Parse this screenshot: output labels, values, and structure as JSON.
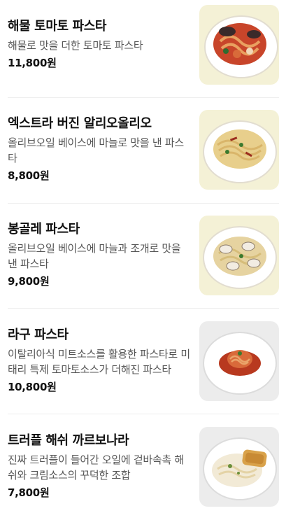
{
  "menu": {
    "items": [
      {
        "name": "해물 토마토 파스타",
        "description": "해물로 맛을 더한 토마토 파스타",
        "price": "11,800원",
        "image": "seafood-tomato-pasta-image",
        "bg": "#f4f1d6"
      },
      {
        "name": "엑스트라 버진 알리오올리오",
        "description": "올리브오일 베이스에 마늘로 맛을 낸 파스타",
        "price": "8,800원",
        "image": "aglio-olio-pasta-image",
        "bg": "#f4f1d6"
      },
      {
        "name": "봉골레 파스타",
        "description": "올리브오일 베이스에 마늘과 조개로 맛을 낸 파스타",
        "price": "9,800원",
        "image": "vongole-pasta-image",
        "bg": "#f4f1d6"
      },
      {
        "name": "라구 파스타",
        "description": "이탈리아식 미트소스를 활용한 파스타로 미태리 특제 토마토소스가 더해진 파스타",
        "price": "10,800원",
        "image": "ragu-pasta-image",
        "bg": "#ececec"
      },
      {
        "name": "트러플 해쉬 까르보나라",
        "description": "진짜 트러플이 들어간 오일에 겉바속촉 해쉬와 크림소스의 꾸덕한 조합",
        "price": "7,800원",
        "image": "truffle-hash-carbonara-image",
        "bg": "#ececec"
      }
    ]
  }
}
